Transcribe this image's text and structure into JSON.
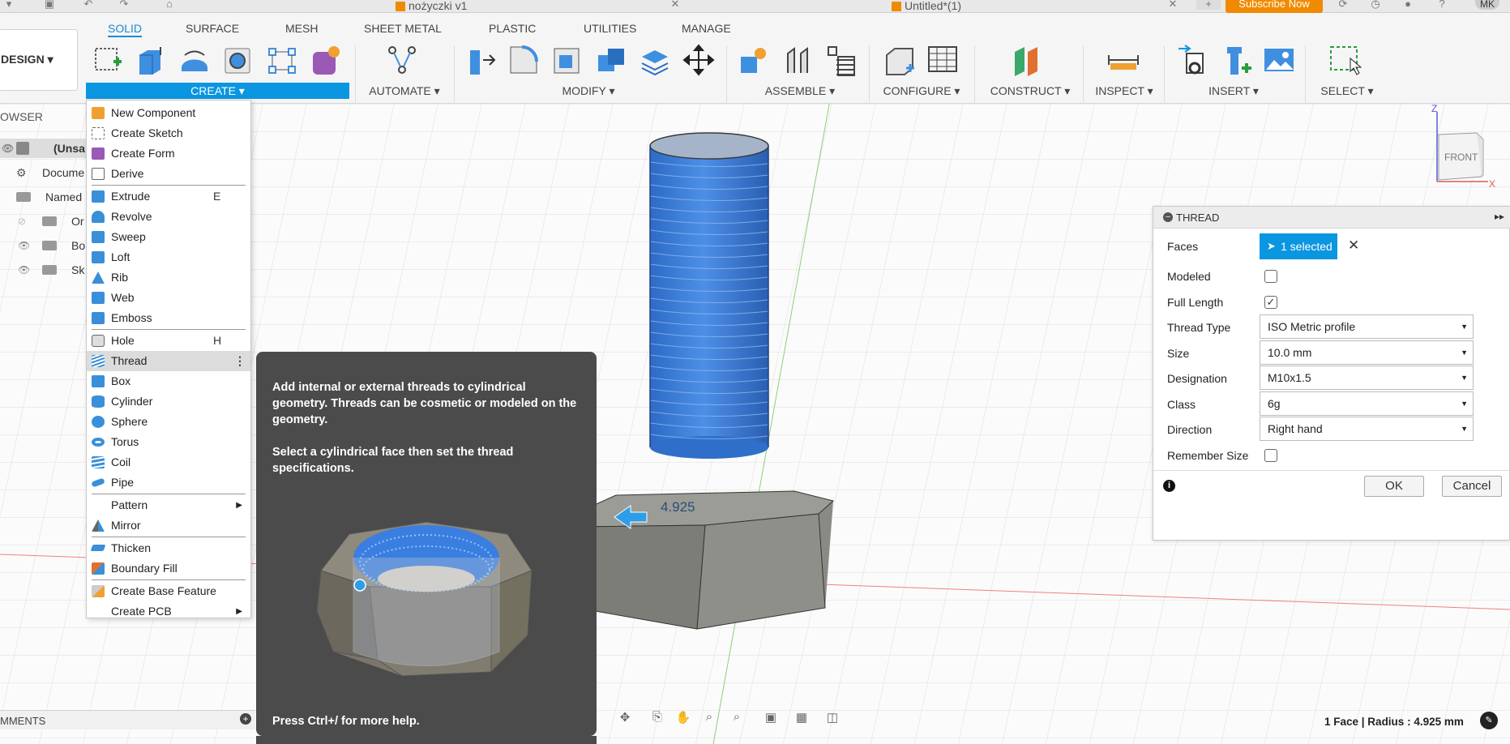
{
  "top_tabs": {
    "doc1": "nożyczki v1",
    "doc2": "Untitled*(1)",
    "subscribe": "Subscribe Now",
    "user": "MK"
  },
  "ribbon": {
    "design": "DESIGN",
    "tabs": [
      "SOLID",
      "SURFACE",
      "MESH",
      "SHEET METAL",
      "PLASTIC",
      "UTILITIES",
      "MANAGE"
    ],
    "groups": {
      "create": "CREATE",
      "automate": "AUTOMATE",
      "modify": "MODIFY",
      "assemble": "ASSEMBLE",
      "configure": "CONFIGURE",
      "construct": "CONSTRUCT",
      "inspect": "INSPECT",
      "insert": "INSERT",
      "select": "SELECT"
    }
  },
  "browser": {
    "title": "OWSER",
    "rows": [
      "(Unsa",
      "Docume",
      "Named",
      "Or",
      "Bo",
      "Sk"
    ]
  },
  "create_menu": {
    "items": [
      {
        "label": "New Component",
        "color": "#f0a030"
      },
      {
        "label": "Create Sketch",
        "color": "#3a8fd9"
      },
      {
        "label": "Create Form",
        "color": "#9b59b6"
      },
      {
        "label": "Derive",
        "color": "#777"
      },
      {
        "label": "Extrude",
        "shortcut": "E",
        "color": "#3a8fd9"
      },
      {
        "label": "Revolve",
        "color": "#3a8fd9"
      },
      {
        "label": "Sweep",
        "color": "#3a8fd9"
      },
      {
        "label": "Loft",
        "color": "#3a8fd9"
      },
      {
        "label": "Rib",
        "color": "#3a8fd9"
      },
      {
        "label": "Web",
        "color": "#3a8fd9"
      },
      {
        "label": "Emboss",
        "color": "#3a8fd9"
      },
      {
        "label": "Hole",
        "shortcut": "H",
        "color": "#666"
      },
      {
        "label": "Thread",
        "color": "#3a8fd9"
      },
      {
        "label": "Box",
        "color": "#3a8fd9"
      },
      {
        "label": "Cylinder",
        "color": "#3a8fd9"
      },
      {
        "label": "Sphere",
        "color": "#3a8fd9"
      },
      {
        "label": "Torus",
        "color": "#3a8fd9"
      },
      {
        "label": "Coil",
        "color": "#3a8fd9"
      },
      {
        "label": "Pipe",
        "color": "#3a8fd9"
      },
      {
        "label": "Pattern"
      },
      {
        "label": "Mirror",
        "color": "#3a8fd9"
      },
      {
        "label": "Thicken",
        "color": "#3a8fd9"
      },
      {
        "label": "Boundary Fill",
        "color": "#e07030"
      },
      {
        "label": "Create Base Feature",
        "color": "#f0a030"
      },
      {
        "label": "Create PCB"
      }
    ]
  },
  "tooltip": {
    "para1": "Add internal or external threads to cylindrical geometry. Threads can be cosmetic or modeled on the geometry.",
    "para2": "Select a cylindrical face then set the thread specifications.",
    "footer": "Press Ctrl+/ for more help."
  },
  "thread_panel": {
    "title": "THREAD",
    "faces_label": "Faces",
    "faces_value": "1 selected",
    "modeled_label": "Modeled",
    "modeled_checked": false,
    "full_length_label": "Full Length",
    "full_length_checked": true,
    "thread_type_label": "Thread Type",
    "thread_type": "ISO Metric profile",
    "size_label": "Size",
    "size": "10.0 mm",
    "designation_label": "Designation",
    "designation": "M10x1.5",
    "class_label": "Class",
    "class": "6g",
    "direction_label": "Direction",
    "direction": "Right hand",
    "remember_label": "Remember Size",
    "remember_checked": false,
    "ok": "OK",
    "cancel": "Cancel"
  },
  "viewport": {
    "dimension_label": "4.925",
    "viewcube_face": "FRONT",
    "axis_z": "Z",
    "axis_x": "X"
  },
  "status": {
    "comments": "MMENTS",
    "selection_info": "1 Face | Radius : 4.925 mm"
  },
  "colors": {
    "accent": "#0a96e0",
    "thread_blue": "#3d7fd6",
    "base_gray": "#8a8a84",
    "tooltip_bg": "#4b4b4b"
  }
}
